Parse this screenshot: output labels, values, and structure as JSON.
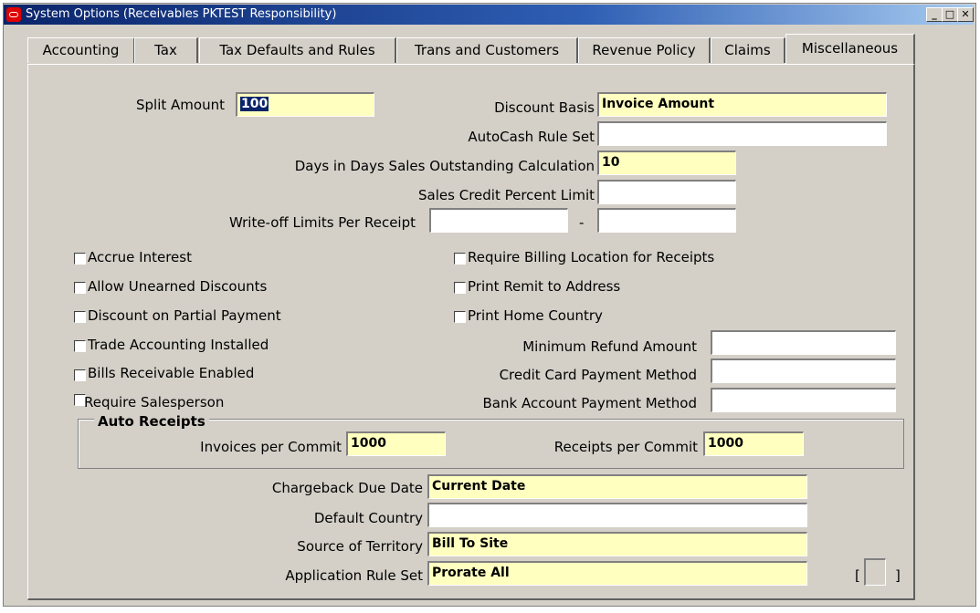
{
  "window": {
    "title": "System Options (Receivables PKTEST Responsibility)",
    "buttons": {
      "minimize": "_",
      "maximize": "□",
      "close": "✕"
    }
  },
  "tabs": [
    {
      "label": "Accounting"
    },
    {
      "label": "Tax"
    },
    {
      "label": "Tax Defaults and Rules"
    },
    {
      "label": "Trans and Customers"
    },
    {
      "label": "Revenue Policy"
    },
    {
      "label": "Claims"
    },
    {
      "label": "Miscellaneous"
    }
  ],
  "fields": {
    "split_amount": {
      "label": "Split Amount",
      "value": "100"
    },
    "discount_basis": {
      "label": "Discount Basis",
      "value": "Invoice Amount"
    },
    "autocash_rule_set": {
      "label": "AutoCash Rule Set",
      "value": ""
    },
    "days_dso": {
      "label": "Days in Days Sales Outstanding Calculation",
      "value": "10"
    },
    "sales_credit_percent_limit": {
      "label": "Sales Credit Percent Limit",
      "value": ""
    },
    "write_off_limits": {
      "label": "Write-off Limits Per Receipt",
      "from": "",
      "separator": "-",
      "to": ""
    },
    "minimum_refund_amount": {
      "label": "Minimum Refund Amount",
      "value": ""
    },
    "credit_card_payment_method": {
      "label": "Credit Card Payment Method",
      "value": ""
    },
    "bank_account_payment_method": {
      "label": "Bank Account Payment Method",
      "value": ""
    },
    "chargeback_due_date": {
      "label": "Chargeback Due Date",
      "value": "Current Date"
    },
    "default_country": {
      "label": "Default Country",
      "value": ""
    },
    "source_of_territory": {
      "label": "Source of Territory",
      "value": "Bill To Site"
    },
    "application_rule_set": {
      "label": "Application Rule Set",
      "value": "Prorate All"
    }
  },
  "checkboxes": {
    "accrue_interest": {
      "label": "Accrue Interest",
      "checked": false
    },
    "allow_unearned_discounts": {
      "label": "Allow Unearned Discounts",
      "checked": false
    },
    "discount_on_partial_payment": {
      "label": "Discount on Partial Payment",
      "checked": false
    },
    "trade_accounting_installed": {
      "label": "Trade Accounting Installed",
      "checked": false
    },
    "bills_receivable_enabled": {
      "label": "Bills Receivable Enabled",
      "checked": false
    },
    "require_salesperson": {
      "label": "Require Salesperson",
      "checked": false
    },
    "require_billing_location": {
      "label": "Require Billing Location for Receipts",
      "checked": false
    },
    "print_remit_to_address": {
      "label": "Print Remit to Address",
      "checked": false
    },
    "print_home_country": {
      "label": "Print Home Country",
      "checked": false
    }
  },
  "auto_receipts": {
    "title": "Auto Receipts",
    "invoices_per_commit": {
      "label": "Invoices per Commit",
      "value": "1000"
    },
    "receipts_per_commit": {
      "label": "Receipts per Commit",
      "value": "1000"
    }
  },
  "descriptive_flex": {
    "open": "[",
    "close": "]"
  },
  "colors": {
    "required_field": "#ffffc0",
    "titlebar": "#0a246a",
    "form_bg": "#d4d0c8"
  }
}
